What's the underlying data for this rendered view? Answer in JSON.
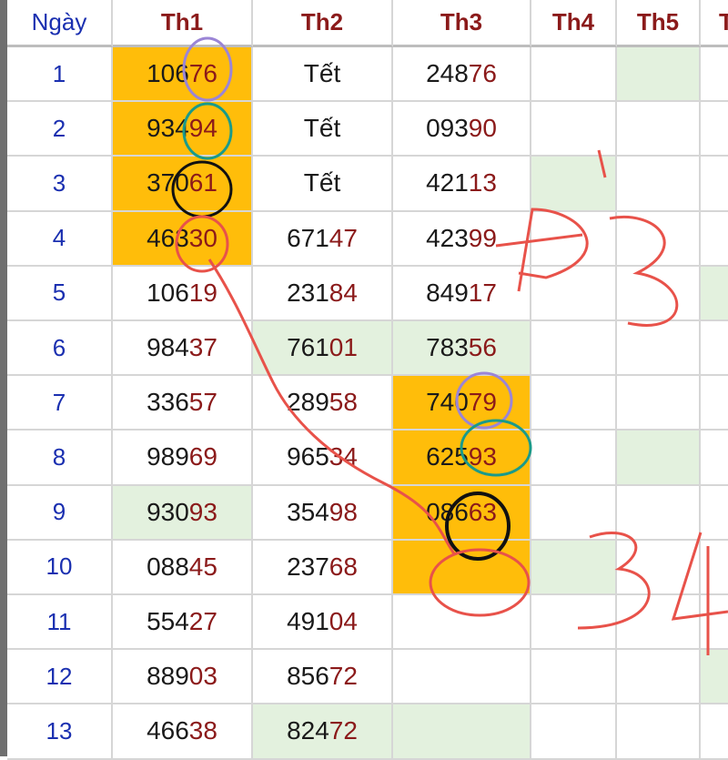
{
  "table": {
    "headers": [
      "Ngày",
      "Th1",
      "Th2",
      "Th3",
      "Th4",
      "Th5",
      "T"
    ],
    "rows": [
      {
        "day": "1",
        "cells": [
          {
            "head": "106",
            "tail": "76",
            "fill": "yellow"
          },
          {
            "text": "Tết"
          },
          {
            "head": "248",
            "tail": "76"
          },
          {},
          {
            "fill": "green"
          },
          {}
        ]
      },
      {
        "day": "2",
        "cells": [
          {
            "head": "934",
            "tail": "94",
            "fill": "yellow"
          },
          {
            "text": "Tết"
          },
          {
            "head": "093",
            "tail": "90"
          },
          {},
          {},
          {}
        ]
      },
      {
        "day": "3",
        "cells": [
          {
            "head": "370",
            "tail": "61",
            "fill": "yellow"
          },
          {
            "text": "Tết"
          },
          {
            "head": "421",
            "tail": "13"
          },
          {
            "fill": "green"
          },
          {},
          {}
        ]
      },
      {
        "day": "4",
        "cells": [
          {
            "head": "463",
            "tail": "30",
            "fill": "yellow"
          },
          {
            "head": "671",
            "tail": "47"
          },
          {
            "head": "423",
            "tail": "99"
          },
          {},
          {},
          {}
        ]
      },
      {
        "day": "5",
        "cells": [
          {
            "head": "106",
            "tail": "19"
          },
          {
            "head": "231",
            "tail": "84"
          },
          {
            "head": "849",
            "tail": "17"
          },
          {},
          {},
          {
            "fill": "green"
          }
        ]
      },
      {
        "day": "6",
        "cells": [
          {
            "head": "984",
            "tail": "37"
          },
          {
            "head": "761",
            "tail": "01",
            "fill": "green"
          },
          {
            "head": "783",
            "tail": "56",
            "fill": "green"
          },
          {},
          {},
          {}
        ]
      },
      {
        "day": "7",
        "cells": [
          {
            "head": "336",
            "tail": "57"
          },
          {
            "head": "289",
            "tail": "58"
          },
          {
            "head": "740",
            "tail": "79",
            "fill": "yellow"
          },
          {},
          {},
          {}
        ]
      },
      {
        "day": "8",
        "cells": [
          {
            "head": "989",
            "tail": "69"
          },
          {
            "head": "965",
            "tail": "34"
          },
          {
            "head": "625",
            "tail": "93",
            "fill": "yellow"
          },
          {},
          {
            "fill": "green"
          },
          {}
        ]
      },
      {
        "day": "9",
        "cells": [
          {
            "head": "930",
            "tail": "93",
            "fill": "green"
          },
          {
            "head": "354",
            "tail": "98"
          },
          {
            "head": "086",
            "tail": "63",
            "fill": "yellow"
          },
          {},
          {},
          {}
        ]
      },
      {
        "day": "10",
        "cells": [
          {
            "head": "088",
            "tail": "45"
          },
          {
            "head": "237",
            "tail": "68"
          },
          {
            "fill": "yellow"
          },
          {
            "fill": "green"
          },
          {},
          {}
        ]
      },
      {
        "day": "11",
        "cells": [
          {
            "head": "554",
            "tail": "27"
          },
          {
            "head": "491",
            "tail": "04"
          },
          {},
          {},
          {},
          {}
        ]
      },
      {
        "day": "12",
        "cells": [
          {
            "head": "889",
            "tail": "03"
          },
          {
            "head": "856",
            "tail": "72"
          },
          {},
          {},
          {},
          {
            "fill": "green"
          }
        ]
      },
      {
        "day": "13",
        "cells": [
          {
            "head": "466",
            "tail": "38"
          },
          {
            "head": "824",
            "tail": "72",
            "fill": "green"
          },
          {
            "fill": "green"
          },
          {},
          {},
          {}
        ]
      }
    ]
  },
  "colors": {
    "highlight": "#ffbd0a",
    "green_fill": "#e3f1de",
    "tail_digits": "#8b1a1a",
    "day_numbers": "#1a2fb0",
    "ink_red": "#e8524a",
    "ink_black": "#111111",
    "ink_purple": "#9b85d6",
    "ink_teal": "#1a9a8a"
  }
}
